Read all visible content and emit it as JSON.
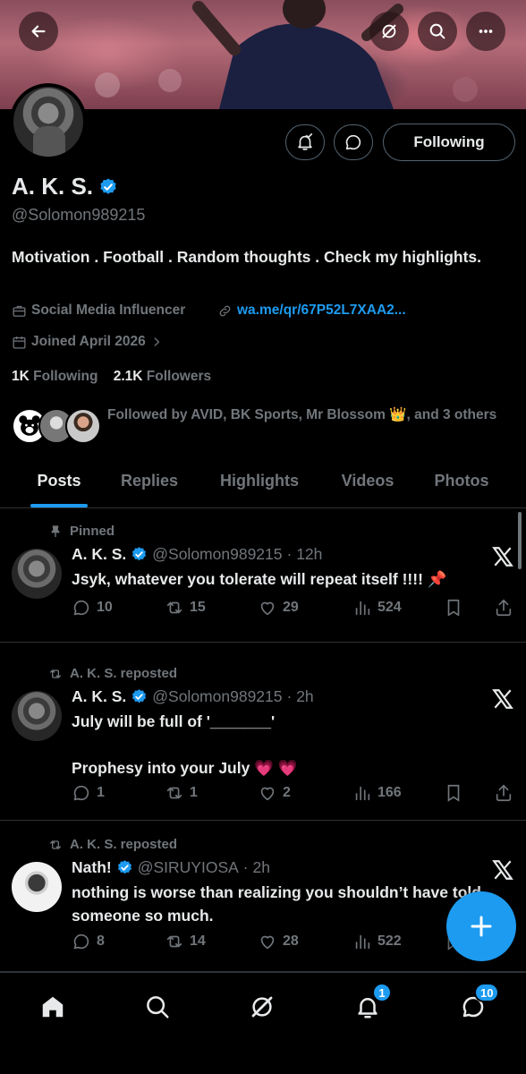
{
  "colors": {
    "accent": "#1d9bf0",
    "background": "#000000",
    "muted": "#71767b",
    "text": "#e7e9ea",
    "pin": "#e0245e"
  },
  "header": {
    "back_icon": "arrow-left-icon",
    "grok_icon": "grok-icon",
    "search_icon": "search-icon",
    "more_icon": "more-icon"
  },
  "profile": {
    "name": "A. K. S.",
    "handle": "@Solomon989215",
    "bio": "Motivation . Football . Random thoughts . Check my highlights.",
    "category": "Social Media Influencer",
    "link": "wa.me/qr/67P52L7XAA2...",
    "joined": "Joined April 2026",
    "following_count": "1K",
    "following_label": "Following",
    "followers_count": "2.1K",
    "followers_label": "Followers",
    "followed_by": "Followed by AVID, BK Sports, Mr Blossom 👑, and 3 others",
    "follow_button": "Following"
  },
  "tabs": [
    "Posts",
    "Replies",
    "Highlights",
    "Videos",
    "Photos"
  ],
  "posts": [
    {
      "context": "Pinned",
      "name": "A. K. S.",
      "handle": "@Solomon989215",
      "time": "· 12h",
      "text": "Jsyk, whatever you tolerate will repeat itself !!!! 📌",
      "replies": "10",
      "reposts": "15",
      "likes": "29",
      "views": "524"
    },
    {
      "context": "A. K. S. reposted",
      "name": "A. K. S.",
      "handle": "@Solomon989215",
      "time": "· 2h",
      "text": "July will be full of '_______'\n\nProphesy into your July 💗 💗",
      "replies": "1",
      "reposts": "1",
      "likes": "2",
      "views": "166"
    },
    {
      "context": "A. K. S. reposted",
      "name": "Nath!",
      "handle": "@SIRUYIOSA",
      "time": "· 2h",
      "text": "nothing is worse than realizing you shouldn’t have told someone so much.",
      "replies": "8",
      "reposts": "14",
      "likes": "28",
      "views": "522"
    }
  ],
  "bottom_nav": {
    "items": [
      "home-icon",
      "search-icon",
      "grok-icon",
      "notifications-icon",
      "messages-icon"
    ],
    "notifications_badge": "1",
    "messages_badge": "10"
  }
}
